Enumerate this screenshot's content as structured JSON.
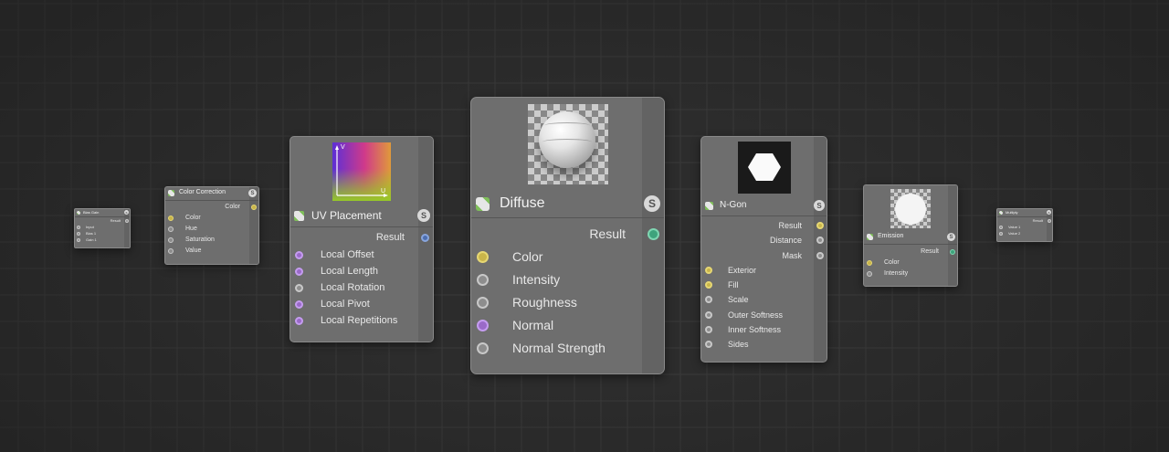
{
  "badge_letter": "S",
  "nodes": {
    "bias_gain": {
      "title": "Bias Gain",
      "outputs": [
        "Result"
      ],
      "inputs": [
        "Input",
        "Bias 1",
        "Gain 1"
      ]
    },
    "color_correction": {
      "title": "Color Correction",
      "outputs": [
        "Color"
      ],
      "inputs": [
        "Color",
        "Hue",
        "Saturation",
        "Value"
      ]
    },
    "uv_placement": {
      "title": "UV Placement",
      "axis_v": "V",
      "axis_u": "U",
      "outputs": [
        "Result"
      ],
      "inputs": [
        "Local Offset",
        "Local Length",
        "Local Rotation",
        "Local Pivot",
        "Local Repetitions"
      ]
    },
    "diffuse": {
      "title": "Diffuse",
      "outputs": [
        "Result"
      ],
      "inputs": [
        "Color",
        "Intensity",
        "Roughness",
        "Normal",
        "Normal Strength"
      ]
    },
    "ngon": {
      "title": "N-Gon",
      "outputs": [
        "Result",
        "Distance",
        "Mask"
      ],
      "inputs": [
        "Exterior",
        "Fill",
        "Scale",
        "Outer Softness",
        "Inner Softness",
        "Sides"
      ]
    },
    "emission": {
      "title": "Emission",
      "outputs": [
        "Result"
      ],
      "inputs": [
        "Color",
        "Intensity"
      ]
    },
    "multiply": {
      "title": "Multiply",
      "outputs": [
        "Result"
      ],
      "inputs": [
        "Value 1",
        "Value 2"
      ]
    }
  },
  "colors": {
    "background": "#2c2c2c",
    "node_body": "#6e6e6e",
    "port_yellow": "#c9b54a",
    "port_grey": "#8d8d8d",
    "port_purple": "#9a6ac8",
    "port_green": "#3ea37c",
    "port_blue": "#4d6fb0"
  }
}
